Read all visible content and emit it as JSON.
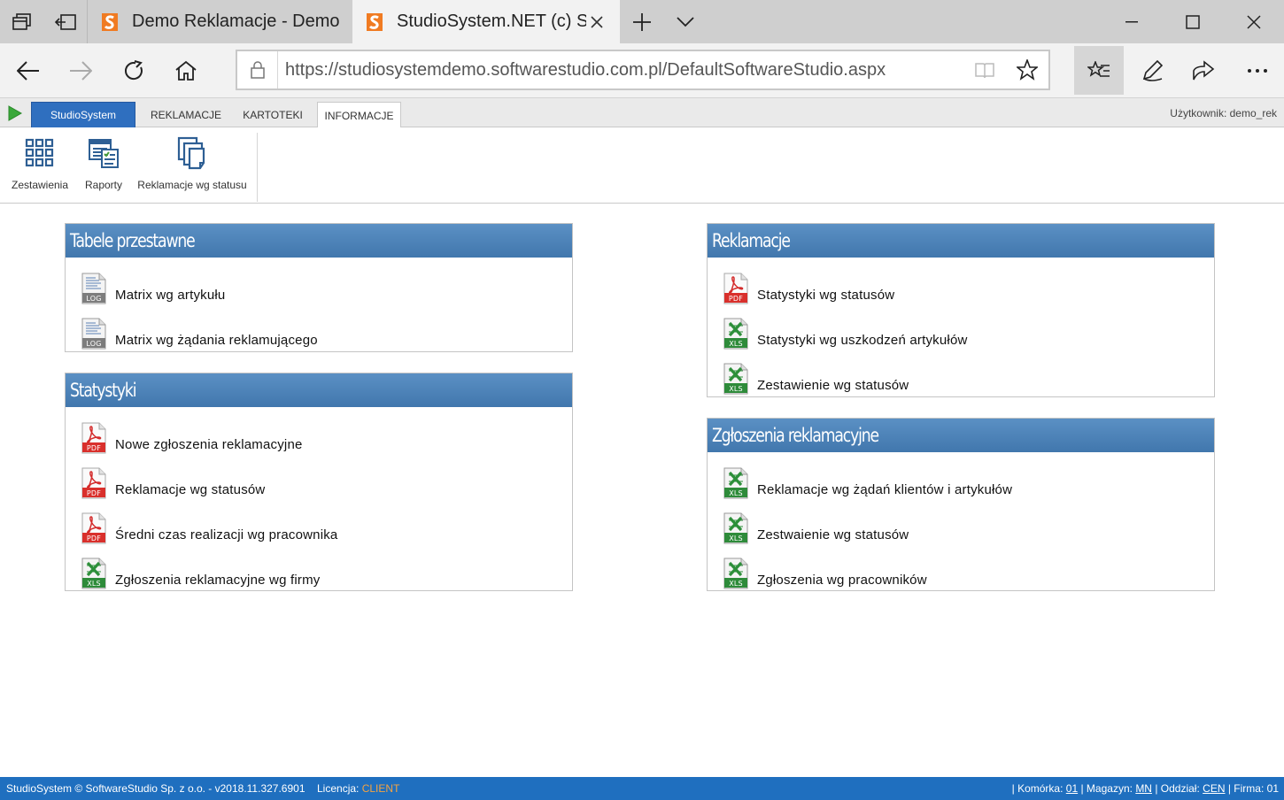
{
  "browser": {
    "tabs": [
      {
        "title": "Demo Reklamacje - Demo c",
        "active": false
      },
      {
        "title": "StudioSystem.NET (c) Sc",
        "active": true
      }
    ],
    "url": "https://studiosystemdemo.softwarestudio.com.pl/DefaultSoftwareStudio.aspx"
  },
  "app": {
    "brand_tab": "StudioSystem",
    "menu_tabs": [
      "REKLAMACJE",
      "KARTOTEKI",
      "INFORMACJE"
    ],
    "active_tab": "INFORMACJE",
    "user_label": "Użytkownik: demo_rek",
    "ribbon": [
      "Zestawienia",
      "Raporty",
      "Reklamacje wg statusu"
    ]
  },
  "panels": {
    "tabele": {
      "title": "Tabele przestawne",
      "items": [
        {
          "label": "Matrix wg artykułu",
          "icon": "log-file-icon"
        },
        {
          "label": "Matrix wg żądania reklamującego",
          "icon": "log-file-icon"
        }
      ]
    },
    "statystyki": {
      "title": "Statystyki",
      "items": [
        {
          "label": "Nowe zgłoszenia reklamacyjne",
          "icon": "pdf-file-icon"
        },
        {
          "label": "Reklamacje wg statusów",
          "icon": "pdf-file-icon"
        },
        {
          "label": "Średni czas realizacji wg pracownika",
          "icon": "pdf-file-icon"
        },
        {
          "label": "Zgłoszenia reklamacyjne wg firmy",
          "icon": "xls-file-icon"
        }
      ]
    },
    "reklamacje": {
      "title": "Reklamacje",
      "items": [
        {
          "label": "Statystyki wg statusów",
          "icon": "pdf-file-icon"
        },
        {
          "label": "Statystyki wg uszkodzeń artykułów",
          "icon": "xls-file-icon"
        },
        {
          "label": "Zestawienie wg statusów",
          "icon": "xls-file-icon"
        }
      ]
    },
    "zgloszenia": {
      "title": "Zgłoszenia reklamacyjne",
      "items": [
        {
          "label": "Reklamacje wg żądań klientów i artykułów",
          "icon": "xls-file-icon"
        },
        {
          "label": "Zestwaienie wg statusów",
          "icon": "xls-file-icon"
        },
        {
          "label": "Zgłoszenia wg pracowników",
          "icon": "xls-file-icon"
        }
      ]
    }
  },
  "status": {
    "left": "StudioSystem © SoftwareStudio Sp. z o.o. - v2018.11.327.6901",
    "license_label": "Licencja:",
    "license_value": "CLIENT",
    "komorka_label": "| Komórka:",
    "komorka_value": "01",
    "magazyn_label": "| Magazyn:",
    "magazyn_value": "MN",
    "oddzial_label": "| Oddział:",
    "oddzial_value": "CEN",
    "firma_label": "| Firma:",
    "firma_value": "01"
  },
  "colors": {
    "panel_header": "#4a82b9",
    "status_bar": "#1f6fbf",
    "brand_tab": "#2f6fbf",
    "license": "#f5a340"
  }
}
